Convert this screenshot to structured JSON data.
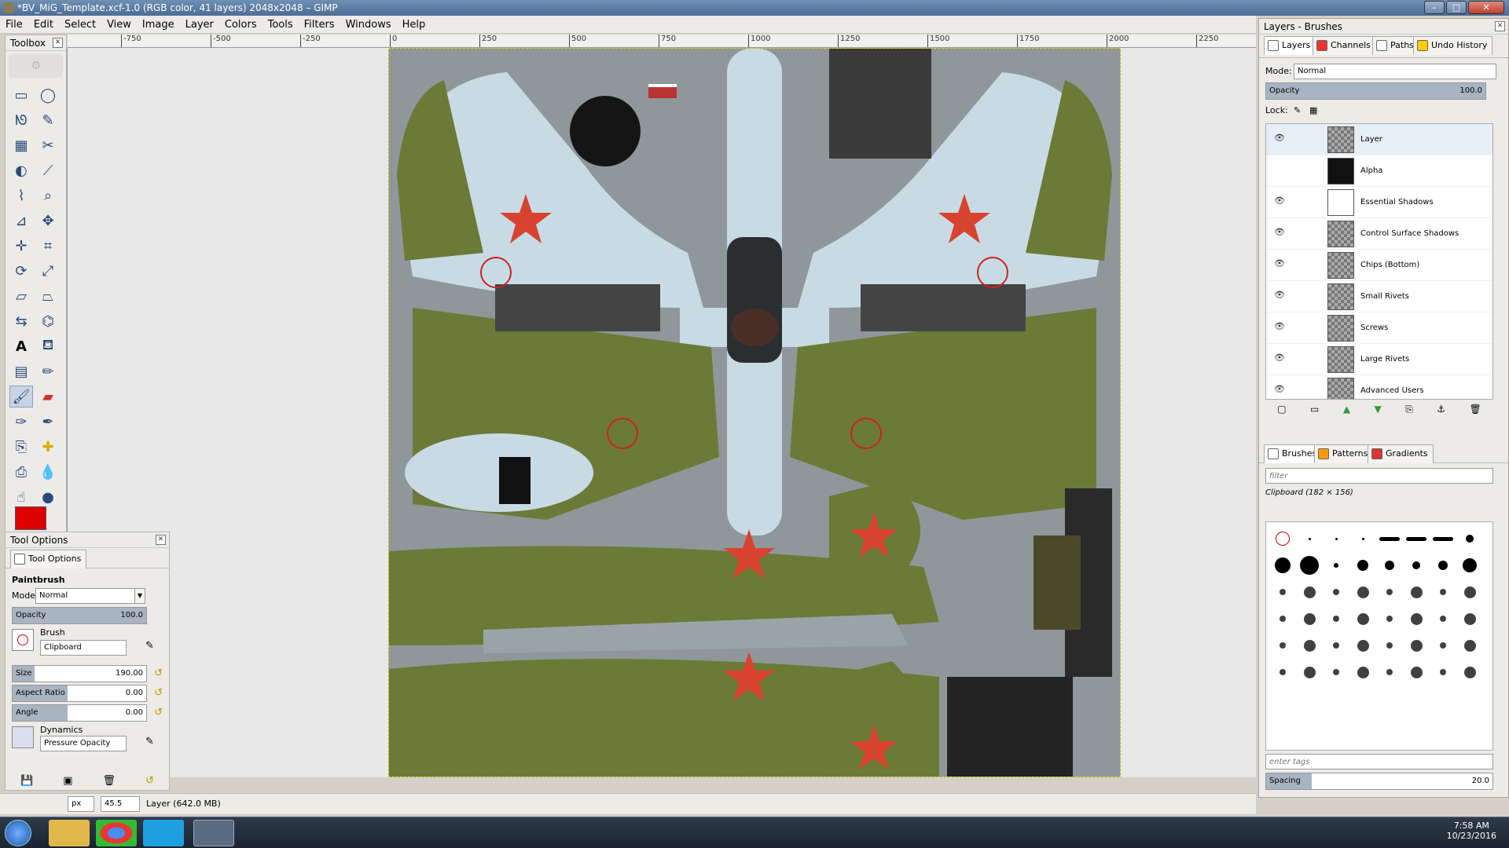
{
  "window": {
    "title": "*BV_MiG_Template.xcf-1.0 (RGB color, 41 layers) 2048x2048 – GIMP"
  },
  "menu": [
    "File",
    "Edit",
    "Select",
    "View",
    "Image",
    "Layer",
    "Colors",
    "Tools",
    "Filters",
    "Windows",
    "Help"
  ],
  "ruler": {
    "ticks": [
      "-750",
      "-500",
      "-250",
      "0",
      "250",
      "500",
      "750",
      "1000",
      "1250",
      "1500",
      "1750",
      "2000",
      "2250"
    ]
  },
  "toolbox": {
    "title": "Toolbox"
  },
  "tool_options": {
    "title": "Tool Options",
    "tab": "Tool Options",
    "tool_name": "Paintbrush",
    "mode_label": "Mode:",
    "mode_value": "Normal",
    "opacity_label": "Opacity",
    "opacity_value": "100.0",
    "opacity_pct": 100,
    "brush_label": "Brush",
    "brush_value": "Clipboard",
    "size_label": "Size",
    "size_value": "190.00",
    "aspect_label": "Aspect Ratio",
    "aspect_value": "0.00",
    "angle_label": "Angle",
    "angle_value": "0.00",
    "dynamics_label": "Dynamics",
    "dynamics_value": "Pressure Opacity"
  },
  "status": {
    "unit": "px",
    "zoom": "45.5",
    "layer_info": "Layer (642.0 MB)"
  },
  "layers_dock": {
    "title": "Layers - Brushes",
    "tabs": [
      "Layers",
      "Channels",
      "Paths",
      "Undo History"
    ],
    "mode_label": "Mode:",
    "mode_value": "Normal",
    "opacity_label": "Opacity",
    "opacity_value": "100.0",
    "opacity_pct": 100,
    "lock_label": "Lock:",
    "layers": [
      {
        "name": "Layer",
        "visible": true,
        "thumb": "checker"
      },
      {
        "name": "Alpha",
        "visible": false,
        "thumb": "black"
      },
      {
        "name": "Essential Shadows",
        "visible": true,
        "thumb": "white"
      },
      {
        "name": "Control Surface Shadows",
        "visible": true,
        "thumb": "checker"
      },
      {
        "name": "Chips (Bottom)",
        "visible": true,
        "thumb": "checker"
      },
      {
        "name": "Small Rivets",
        "visible": true,
        "thumb": "checker"
      },
      {
        "name": "Screws",
        "visible": true,
        "thumb": "checker"
      },
      {
        "name": "Large Rivets",
        "visible": true,
        "thumb": "checker"
      },
      {
        "name": "Advanced Users",
        "visible": true,
        "thumb": "checker"
      }
    ]
  },
  "brushes_dock": {
    "tabs": [
      "Brushes",
      "Patterns",
      "Gradients"
    ],
    "filter_placeholder": "filter",
    "current_brush": "Clipboard (182 × 156)",
    "tags_placeholder": "enter tags",
    "spacing_label": "Spacing",
    "spacing_value": "20.0",
    "spacing_pct": 20
  },
  "taskbar": {
    "time": "7:58 AM",
    "date": "10/23/2016"
  },
  "colors": {
    "fg": "#e00000",
    "olive": "#6b7a36",
    "sky": "#c8dbe4",
    "star": "#d8432f"
  }
}
